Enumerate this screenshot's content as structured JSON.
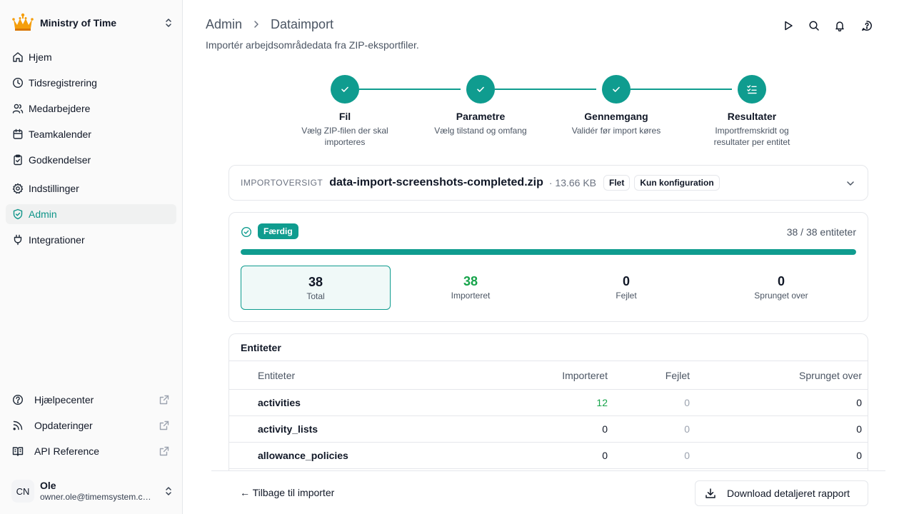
{
  "sidebar": {
    "org_name": "Ministry of Time",
    "nav": [
      {
        "label": "Hjem",
        "icon": "home-icon"
      },
      {
        "label": "Tidsregistrering",
        "icon": "clock-icon"
      },
      {
        "label": "Medarbejdere",
        "icon": "users-icon"
      },
      {
        "label": "Teamkalender",
        "icon": "calendar-icon"
      },
      {
        "label": "Godkendelser",
        "icon": "clipboard-check-icon"
      },
      {
        "label": "Indstillinger",
        "icon": "gear-icon"
      },
      {
        "label": "Admin",
        "icon": "shield-check-icon"
      },
      {
        "label": "Integrationer",
        "icon": "plug-icon"
      }
    ],
    "footer": [
      {
        "label": "Hjælpecenter",
        "icon": "help-circle-icon"
      },
      {
        "label": "Opdateringer",
        "icon": "rss-icon"
      },
      {
        "label": "API Reference",
        "icon": "book-icon"
      }
    ],
    "user": {
      "initials": "CN",
      "name": "Ole",
      "email": "owner.ole@timemsystem.com"
    }
  },
  "header": {
    "crumb_root": "Admin",
    "crumb_current": "Dataimport",
    "subtitle": "Importér arbejdsområdedata fra ZIP-eksportfiler."
  },
  "steps": [
    {
      "title": "Fil",
      "desc": "Vælg ZIP-filen der skal importeres"
    },
    {
      "title": "Parametre",
      "desc": "Vælg tilstand og omfang"
    },
    {
      "title": "Gennemgang",
      "desc": "Validér før import køres"
    },
    {
      "title": "Resultater",
      "desc": "Importfremskridt og resultater per entitet"
    }
  ],
  "overview": {
    "label": "IMPORTOVERSIGT",
    "file": "data-import-screenshots-completed.zip",
    "size": "· 13.66 KB",
    "chips": [
      "Flet",
      "Kun konfiguration"
    ]
  },
  "status": {
    "badge": "Færdig",
    "count": "38 / 38 entiteter",
    "progress_percent": 100,
    "stats": [
      {
        "value": "38",
        "label": "Total"
      },
      {
        "value": "38",
        "label": "Importeret"
      },
      {
        "value": "0",
        "label": "Fejlet"
      },
      {
        "value": "0",
        "label": "Sprunget over"
      }
    ]
  },
  "entities": {
    "title": "Entiteter",
    "columns": [
      "Entiteter",
      "Importeret",
      "Fejlet",
      "Sprunget over"
    ],
    "rows": [
      [
        "activities",
        "12",
        "0",
        "0"
      ],
      [
        "activity_lists",
        "0",
        "0",
        "0"
      ],
      [
        "allowance_policies",
        "0",
        "0",
        "0"
      ]
    ]
  },
  "footer": {
    "back": "← Tilbage til importer",
    "download": "Download detaljeret rapport"
  }
}
